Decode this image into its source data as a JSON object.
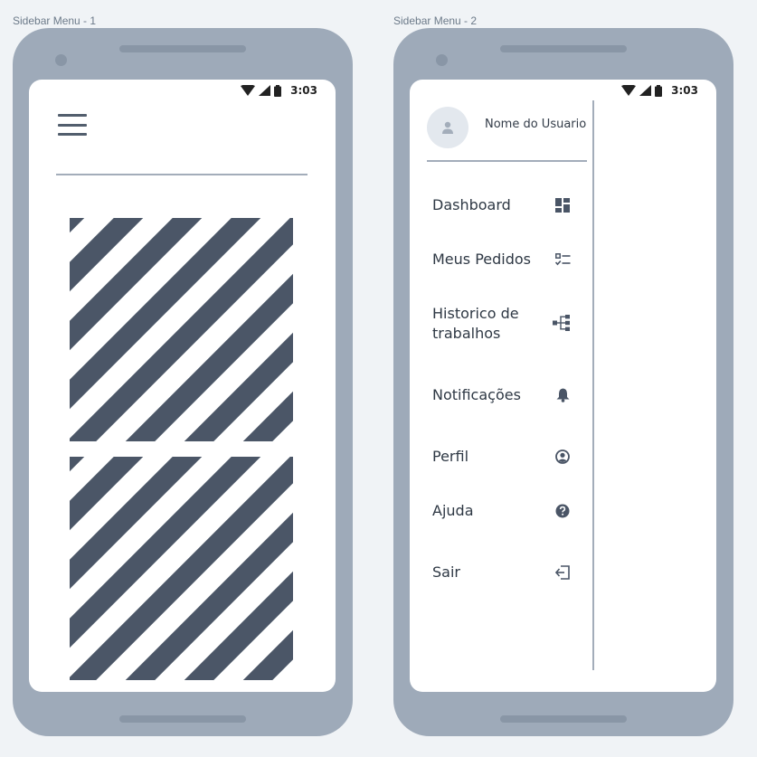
{
  "frames": [
    {
      "label": "Sidebar Menu - 1",
      "status": {
        "time": "3:03"
      }
    },
    {
      "label": "Sidebar Menu - 2",
      "status": {
        "time": "3:03"
      },
      "drawer": {
        "user_name": "Nome do Usuario",
        "items": [
          {
            "label": "Dashboard",
            "icon": "dashboard-icon"
          },
          {
            "label": "Meus Pedidos",
            "icon": "checklist-icon"
          },
          {
            "label": "Historico de trabalhos",
            "icon": "tree-icon"
          },
          {
            "label": "Notificações",
            "icon": "bell-icon"
          },
          {
            "label": "Perfil",
            "icon": "account-circle-icon"
          },
          {
            "label": "Ajuda",
            "icon": "help-circle-icon"
          },
          {
            "label": "Sair",
            "icon": "logout-icon"
          }
        ]
      }
    }
  ],
  "colors": {
    "background": "#f0f3f6",
    "phone_body": "#9eaab9",
    "accent_dark": "#4a5566",
    "divider": "#a3adba"
  }
}
